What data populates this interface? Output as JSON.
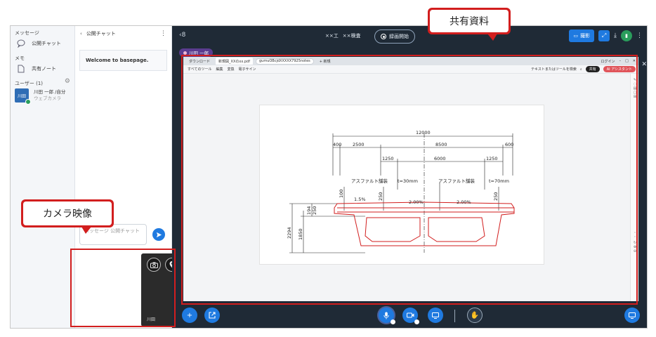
{
  "sidebar": {
    "section_messages": "メッセージ",
    "public_chat": "公開チャット",
    "section_memo": "メモ",
    "shared_note": "共有ノート",
    "section_users": "ユーザー (1)",
    "user_name": "川田 一郎 /自分",
    "user_sub": "ウェブカメラ",
    "avatar_text": "川田"
  },
  "chat": {
    "title": "公開チャット",
    "welcome": "Welcome to basepage.",
    "input_placeholder": "メッセージ 公開チャット"
  },
  "camera": {
    "label": "川田"
  },
  "topbar": {
    "meeting_a": "××工",
    "meeting_b": "××検査",
    "record_label": "録画開始",
    "share_label": "撮影"
  },
  "presenter_tag": "川田 一郎",
  "browser": {
    "tab1": "ダウンロード",
    "tab2": "新規図_XXのxx.pdf",
    "url": "gumuOBcjdXXXXX7925notes",
    "new_tab": "+ 新規",
    "login": "ログイン"
  },
  "pdf": {
    "menu": [
      "すべてのツール",
      "編集",
      "変換",
      "電子サイン"
    ],
    "search": "テキストまたはツールを検索",
    "share": "共有",
    "ai": "AI アシスタント"
  },
  "drawing": {
    "dims": {
      "total": "12000",
      "d400": "400",
      "d2500": "2500",
      "d8500": "8500",
      "d600": "600",
      "d1250a": "1250",
      "d6000": "6000",
      "d1250b": "1250",
      "h2294": "2294",
      "h1850": "1850",
      "h194": "194",
      "h250a": "250",
      "h100": "100",
      "h250b": "250",
      "h250c": "250"
    },
    "pave_left": "アスファルト舗装",
    "pave_left_t": "t=30mm",
    "pave_right": "アスファルト舗装",
    "pave_right_t": "t=70mm",
    "slope_a": "1.5%",
    "slope_b": "2.00%",
    "slope_c": "2.00%"
  },
  "annotations": {
    "shared_material": "共有資料",
    "camera_video": "カメラ映像"
  },
  "colors": {
    "accent_blue": "#1f7ae0",
    "dark_bg": "#1f2a36",
    "annotation_red": "#d21e1e",
    "user_green": "#2a9d5c"
  }
}
